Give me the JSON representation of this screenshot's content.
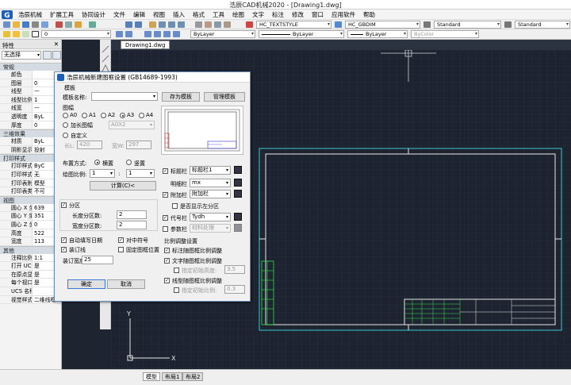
{
  "window": {
    "title": "浩辰CAD机械2020 - [Drawing1.dwg]"
  },
  "menu": [
    "浩辰机械",
    "扩展工具",
    "协同设计",
    "文件",
    "编辑",
    "视图",
    "插入",
    "格式",
    "工具",
    "绘图",
    "文字",
    "标注",
    "修改",
    "窗口",
    "应用软件",
    "帮助"
  ],
  "toolbar": {
    "text_style": "HC_TEXTSTYLE",
    "dim_style": "HC_GBDIM",
    "table_style": "Standard",
    "multileader_style": "Standard",
    "layer_value": "0",
    "color": "ByLayer",
    "linetype": "ByLayer",
    "lineweight": "ByLayer",
    "plotstyle": "ByColor"
  },
  "properties": {
    "title": "特性",
    "selection": "无选择",
    "sections": [
      {
        "name": "常规",
        "rows": [
          [
            "颜色",
            ""
          ],
          [
            "图层",
            "0"
          ],
          [
            "线型",
            "—"
          ],
          [
            "线型比例",
            "1"
          ],
          [
            "线宽",
            "—"
          ],
          [
            "透明度",
            "ByL"
          ],
          [
            "厚度",
            "0"
          ]
        ]
      },
      {
        "name": "三维效果",
        "rows": [
          [
            "材质",
            "ByL"
          ],
          [
            "阴影显示",
            "投射"
          ]
        ]
      },
      {
        "name": "打印样式",
        "rows": [
          [
            "打印样式",
            "ByC"
          ],
          [
            "打印样式表",
            "无"
          ],
          [
            "打印表附...",
            "模型"
          ],
          [
            "打印表类型",
            "不可"
          ]
        ]
      },
      {
        "name": "视图",
        "rows": [
          [
            "圆心 X 坐标",
            "639"
          ],
          [
            "圆心 Y 坐标",
            "351"
          ],
          [
            "圆心 Z 坐标",
            "0"
          ],
          [
            "高度",
            "522"
          ],
          [
            "宽度",
            "113"
          ]
        ]
      },
      {
        "name": "其他",
        "rows": [
          [
            "注释比例",
            "1:1"
          ],
          [
            "打开 UCS...",
            "是"
          ],
          [
            "在原点显...",
            "是"
          ],
          [
            "每个视口...",
            "是"
          ],
          [
            "UCS 名称",
            ""
          ],
          [
            "视觉样式",
            "二维线框"
          ]
        ]
      }
    ]
  },
  "doc_tab": "Drawing1.dwg",
  "layout_tabs": [
    "模型",
    "布局1",
    "布局2"
  ],
  "dialog": {
    "title": "浩辰机械新建图框设置 (GB14689-1993)",
    "template_group": "模板",
    "template_name_label": "模板名称:",
    "save_template": "存为模板",
    "manage_template": "管理模板",
    "sheet_group": "图幅",
    "sheets": [
      "A0",
      "A1",
      "A2",
      "A3",
      "A4"
    ],
    "selected_sheet": "A3",
    "extended_sheet": "加长图幅",
    "extended_value": "A0X2",
    "custom": "自定义",
    "len_label": "长L:",
    "len_value": "420",
    "width_label": "宽W:",
    "width_value": "297",
    "layout_label": "布置方式:",
    "landscape": "横置",
    "portrait": "竖置",
    "scale_label": "绘图比例:",
    "scale_a": "1",
    "scale_sep": ":",
    "scale_b": "1",
    "calc_button": "计算(C)<",
    "partition": "分区",
    "len_parts_label": "长度分区数:",
    "len_parts": "2",
    "wid_parts_label": "宽度分区数:",
    "wid_parts": "2",
    "auto_date": "自动填写日期",
    "center_mark": "对中符号",
    "binding_line": "装订线",
    "fixed_frame": "固定图框位置",
    "binding_width_label": "装订宽度",
    "binding_width": "25",
    "ok": "确定",
    "cancel": "取消",
    "title_block_label": "标题栏",
    "title_block_value": "标题栏1",
    "detail_label": "明细栏",
    "detail_value": "mx",
    "extra_label": "附加栏",
    "extra_value": "附加栏",
    "show_left_partition": "是否显示左分区",
    "code_label": "代号栏",
    "code_value": "Tydh",
    "param_label": "参数栏",
    "param_value": "材料处理",
    "scale_group": "比例调整设置",
    "opt1": "标注随图框比例调整",
    "opt2": "文字随图框比例调整",
    "opt2_sub": "指定初始高度:",
    "opt2_val": "3.5",
    "opt3": "线型随图框比例调整",
    "opt3_sub": "指定初始比例:",
    "opt3_val": "0.3"
  }
}
